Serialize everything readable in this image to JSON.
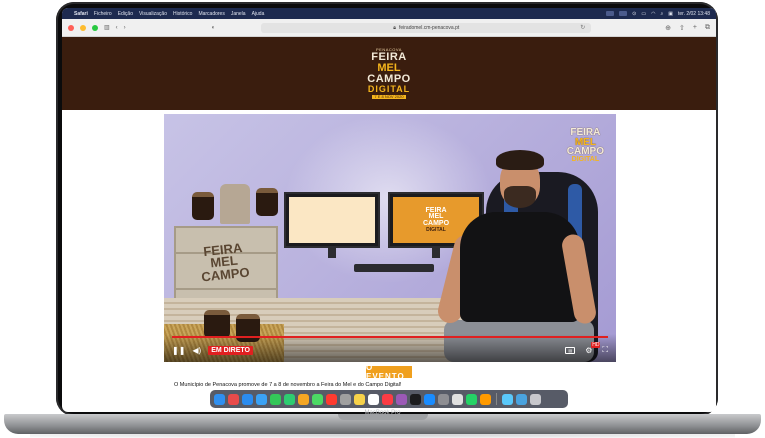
{
  "menubar": {
    "app": "Safari",
    "items": [
      "Ficheiro",
      "Edição",
      "Visualização",
      "Histórico",
      "Marcadores",
      "Janela",
      "Ajuda"
    ],
    "clock": "ter. 2/02 13:48"
  },
  "browser": {
    "url": "feiradomel.cm-penacova.pt"
  },
  "logo": {
    "top": "PENACOVA",
    "line1": "FEIRA",
    "line2": "MEL",
    "line3": "CAMPO",
    "line4": "DIGITAL",
    "date": "7 E 8 NOV 2020",
    "small_do": "DO",
    "small_edo": "E DO"
  },
  "video": {
    "corner_logo": [
      "FEIRA",
      "MEL",
      "CAMPO",
      "DIGITAL"
    ],
    "crate_text": [
      "FEIRA",
      "MEL",
      "CAMPO"
    ],
    "live_label": "EM DIRETO",
    "hd_label": "HD",
    "progress": 1.0
  },
  "section": {
    "title": "O EVENTO",
    "intro": "O Município de Penacova promove de 7 a 8 de novembro a Feira do Mel e do Campo Digital!"
  },
  "dock": {
    "icons": [
      "finder-icon",
      "launchpad-icon",
      "safari-icon",
      "mail-icon",
      "messages-icon",
      "facetime-icon",
      "photos-icon",
      "maps-icon",
      "calendar-icon",
      "contacts-icon",
      "notes-icon",
      "reminders-icon",
      "music-icon",
      "podcasts-icon",
      "tv-icon",
      "appstore-icon",
      "settings-icon",
      "chrome-icon",
      "whatsapp-icon",
      "illustrator-icon",
      "folder-icon",
      "downloads-icon",
      "trash-icon"
    ],
    "colors": [
      "#2f8ff0",
      "#e94b4b",
      "#2b8cf0",
      "#3ba2f5",
      "#34c759",
      "#2ecc71",
      "#f5a623",
      "#4cd964",
      "#ff3b30",
      "#a0a0a0",
      "#f7d24a",
      "#ffffff",
      "#fc3c44",
      "#9b59b6",
      "#1c1c1e",
      "#1a8cff",
      "#8e8e93",
      "#e0e0e0",
      "#25d366",
      "#ff9a00",
      "#5ac8fa",
      "#4aa3df",
      "#c7c7cc"
    ]
  },
  "device_label": "MacBook Pro",
  "colors": {
    "header_brown": "#3a1d0e",
    "honey": "#f5b51c",
    "live_red": "#e02020",
    "section_orange": "#f0a01e"
  }
}
